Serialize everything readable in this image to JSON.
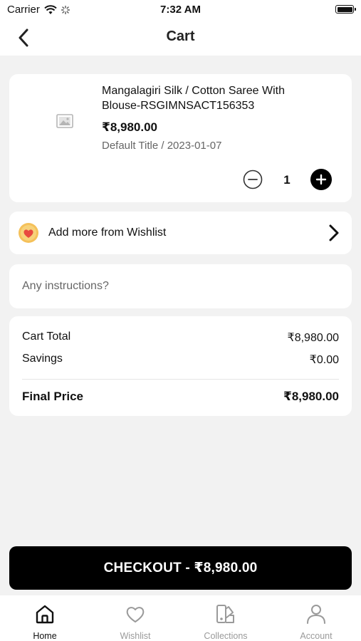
{
  "status_bar": {
    "carrier": "Carrier",
    "time": "7:32 AM"
  },
  "header": {
    "title": "Cart"
  },
  "cart_items": [
    {
      "name": "Mangalagiri Silk / Cotton Saree With Blouse-RSGIMNSACT156353",
      "price": "₹8,980.00",
      "variant": "Default Title / 2023-01-07",
      "quantity": "1"
    }
  ],
  "wishlist_link": {
    "label": "Add more from Wishlist"
  },
  "instructions": {
    "placeholder": "Any instructions?",
    "value": ""
  },
  "summary": {
    "cart_total_label": "Cart Total",
    "cart_total_value": "₹8,980.00",
    "savings_label": "Savings",
    "savings_value": "₹0.00",
    "final_label": "Final Price",
    "final_value": "₹8,980.00"
  },
  "checkout": {
    "label": "CHECKOUT - ₹8,980.00"
  },
  "tabs": [
    {
      "label": "Home",
      "icon": "home-icon",
      "active": true
    },
    {
      "label": "Wishlist",
      "icon": "heart-icon",
      "active": false
    },
    {
      "label": "Collections",
      "icon": "collections-icon",
      "active": false
    },
    {
      "label": "Account",
      "icon": "person-icon",
      "active": false
    }
  ],
  "colors": {
    "background": "#f2f2f2",
    "card": "#ffffff",
    "primary": "#000000",
    "inactive_tab": "#9a9a9a",
    "wishlist_heart": "#e8493f",
    "wishlist_badge": "#f5c15a"
  }
}
